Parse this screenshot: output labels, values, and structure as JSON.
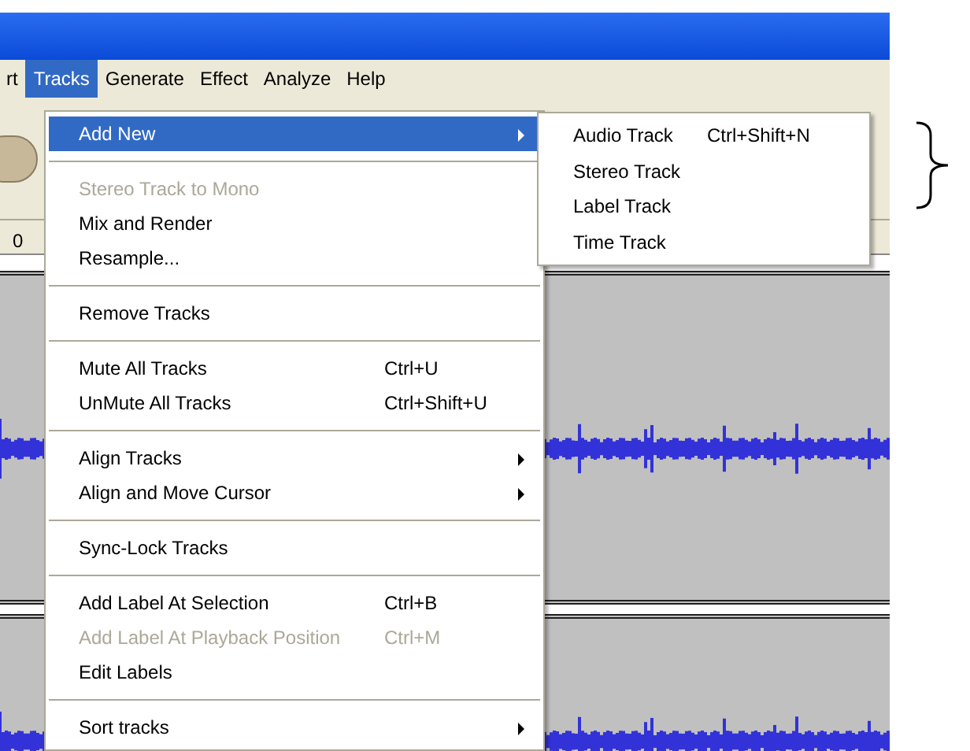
{
  "menu_bar": [
    {
      "label": "rt",
      "selected": false
    },
    {
      "label": "Tracks",
      "selected": true
    },
    {
      "label": "Generate",
      "selected": false
    },
    {
      "label": "Effect",
      "selected": false
    },
    {
      "label": "Analyze",
      "selected": false
    },
    {
      "label": "Help",
      "selected": false
    }
  ],
  "ruler": {
    "label": "0"
  },
  "tracks_menu": {
    "items": [
      {
        "kind": "item",
        "label": "Add New",
        "submenu": true,
        "disabled": false,
        "selected": true
      },
      {
        "kind": "separator"
      },
      {
        "kind": "item",
        "label": "Stereo Track to Mono",
        "submenu": false,
        "disabled": true,
        "selected": false
      },
      {
        "kind": "item",
        "label": "Mix and Render",
        "submenu": false,
        "disabled": false,
        "selected": false
      },
      {
        "kind": "item",
        "label": "Resample...",
        "submenu": false,
        "disabled": false,
        "selected": false
      },
      {
        "kind": "separator"
      },
      {
        "kind": "item",
        "label": "Remove Tracks",
        "submenu": false,
        "disabled": false,
        "selected": false
      },
      {
        "kind": "separator"
      },
      {
        "kind": "item",
        "label": "Mute All Tracks",
        "shortcut": "Ctrl+U",
        "submenu": false,
        "disabled": false,
        "selected": false
      },
      {
        "kind": "item",
        "label": "UnMute All Tracks",
        "shortcut": "Ctrl+Shift+U",
        "submenu": false,
        "disabled": false,
        "selected": false
      },
      {
        "kind": "separator"
      },
      {
        "kind": "item",
        "label": "Align Tracks",
        "submenu": true,
        "disabled": false,
        "selected": false
      },
      {
        "kind": "item",
        "label": "Align and Move Cursor",
        "submenu": true,
        "disabled": false,
        "selected": false
      },
      {
        "kind": "separator"
      },
      {
        "kind": "item",
        "label": "Sync-Lock Tracks",
        "submenu": false,
        "disabled": false,
        "selected": false
      },
      {
        "kind": "separator"
      },
      {
        "kind": "item",
        "label": "Add Label At Selection",
        "shortcut": "Ctrl+B",
        "submenu": false,
        "disabled": false,
        "selected": false
      },
      {
        "kind": "item",
        "label": "Add Label At Playback Position",
        "shortcut": "Ctrl+M",
        "submenu": false,
        "disabled": true,
        "selected": false
      },
      {
        "kind": "item",
        "label": "Edit Labels",
        "submenu": false,
        "disabled": false,
        "selected": false
      },
      {
        "kind": "separator"
      },
      {
        "kind": "item",
        "label": "Sort tracks",
        "submenu": true,
        "disabled": false,
        "selected": false
      }
    ]
  },
  "add_new_submenu": {
    "items": [
      {
        "label": "Audio Track",
        "shortcut": "Ctrl+Shift+N"
      },
      {
        "label": "Stereo Track"
      },
      {
        "label": "Label Track"
      },
      {
        "label": "Time Track"
      }
    ]
  }
}
